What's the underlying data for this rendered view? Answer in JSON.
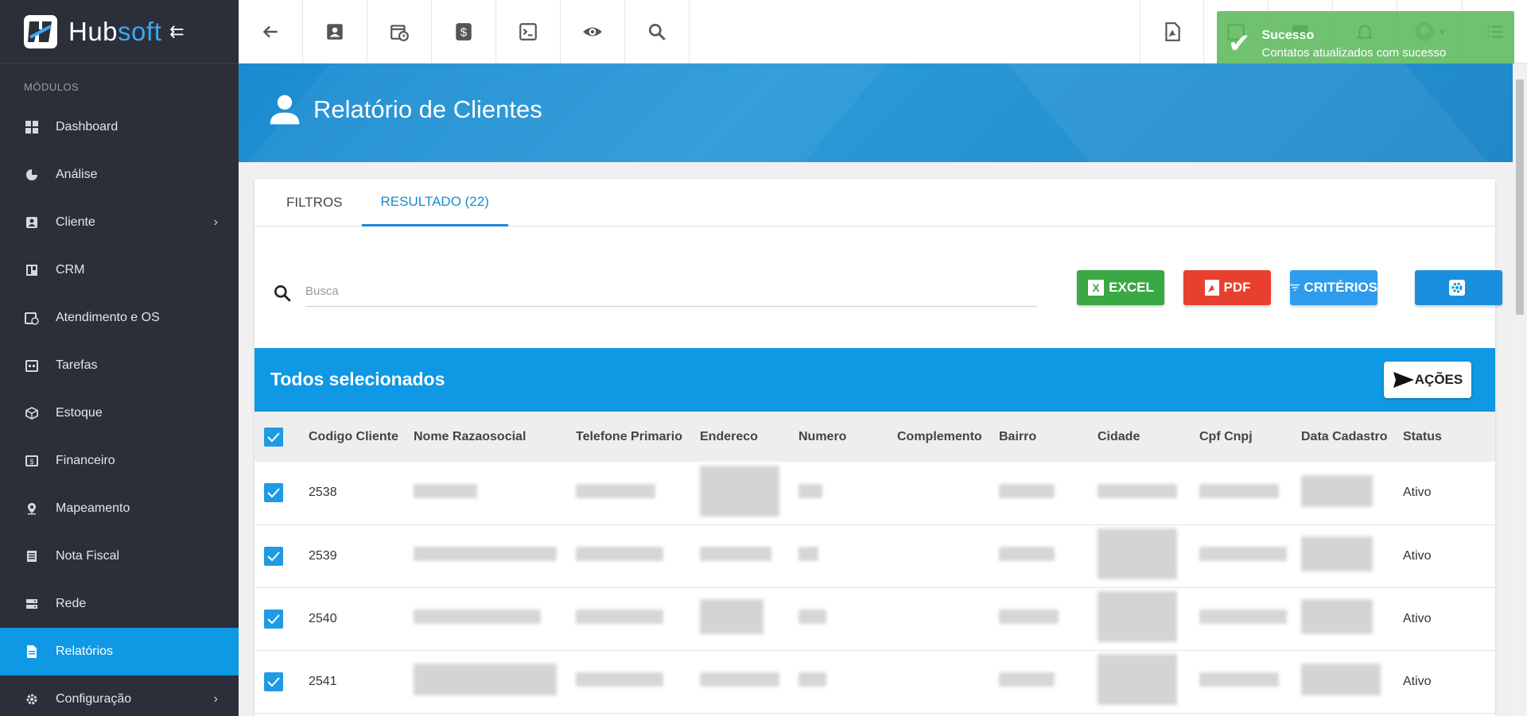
{
  "brand": {
    "name_part1": "Hub",
    "name_part2": "soft"
  },
  "sidebar": {
    "section_label": "MÓDULOS",
    "items": [
      {
        "label": "Dashboard"
      },
      {
        "label": "Análise"
      },
      {
        "label": "Cliente"
      },
      {
        "label": "CRM"
      },
      {
        "label": "Atendimento e OS"
      },
      {
        "label": "Tarefas"
      },
      {
        "label": "Estoque"
      },
      {
        "label": "Financeiro"
      },
      {
        "label": "Mapeamento"
      },
      {
        "label": "Nota Fiscal"
      },
      {
        "label": "Rede"
      },
      {
        "label": "Relatórios"
      },
      {
        "label": "Configuração"
      }
    ]
  },
  "toast": {
    "title": "Sucesso",
    "message": "Contatos atualizados com sucesso"
  },
  "page": {
    "title": "Relatório de Clientes"
  },
  "tabs": [
    {
      "label": "FILTROS"
    },
    {
      "label": "RESULTADO (22)"
    }
  ],
  "search": {
    "placeholder": "Busca"
  },
  "actions": {
    "excel": "EXCEL",
    "pdf": "PDF",
    "criterios": "CRITÉRIOS"
  },
  "selection": {
    "title": "Todos selecionados",
    "actions_label": "AÇÕES"
  },
  "table": {
    "headers": [
      "Codigo Cliente",
      "Nome Razaosocial",
      "Telefone Primario",
      "Endereco",
      "Numero",
      "Complemento",
      "Bairro",
      "Cidade",
      "Cpf Cnpj",
      "Data Cadastro",
      "Status"
    ],
    "rows": [
      {
        "codigo": "2538",
        "status": "Ativo"
      },
      {
        "codigo": "2539",
        "status": "Ativo"
      },
      {
        "codigo": "2540",
        "status": "Ativo"
      },
      {
        "codigo": "2541",
        "status": "Ativo"
      }
    ]
  },
  "colors": {
    "sidebar_bg": "#2c2f3a",
    "accent": "#0f98e4",
    "excel": "#3aa845",
    "pdf": "#e8402e",
    "criterios": "#2f9bec",
    "settings": "#1a8fe0",
    "toast": "#5cb85c"
  }
}
